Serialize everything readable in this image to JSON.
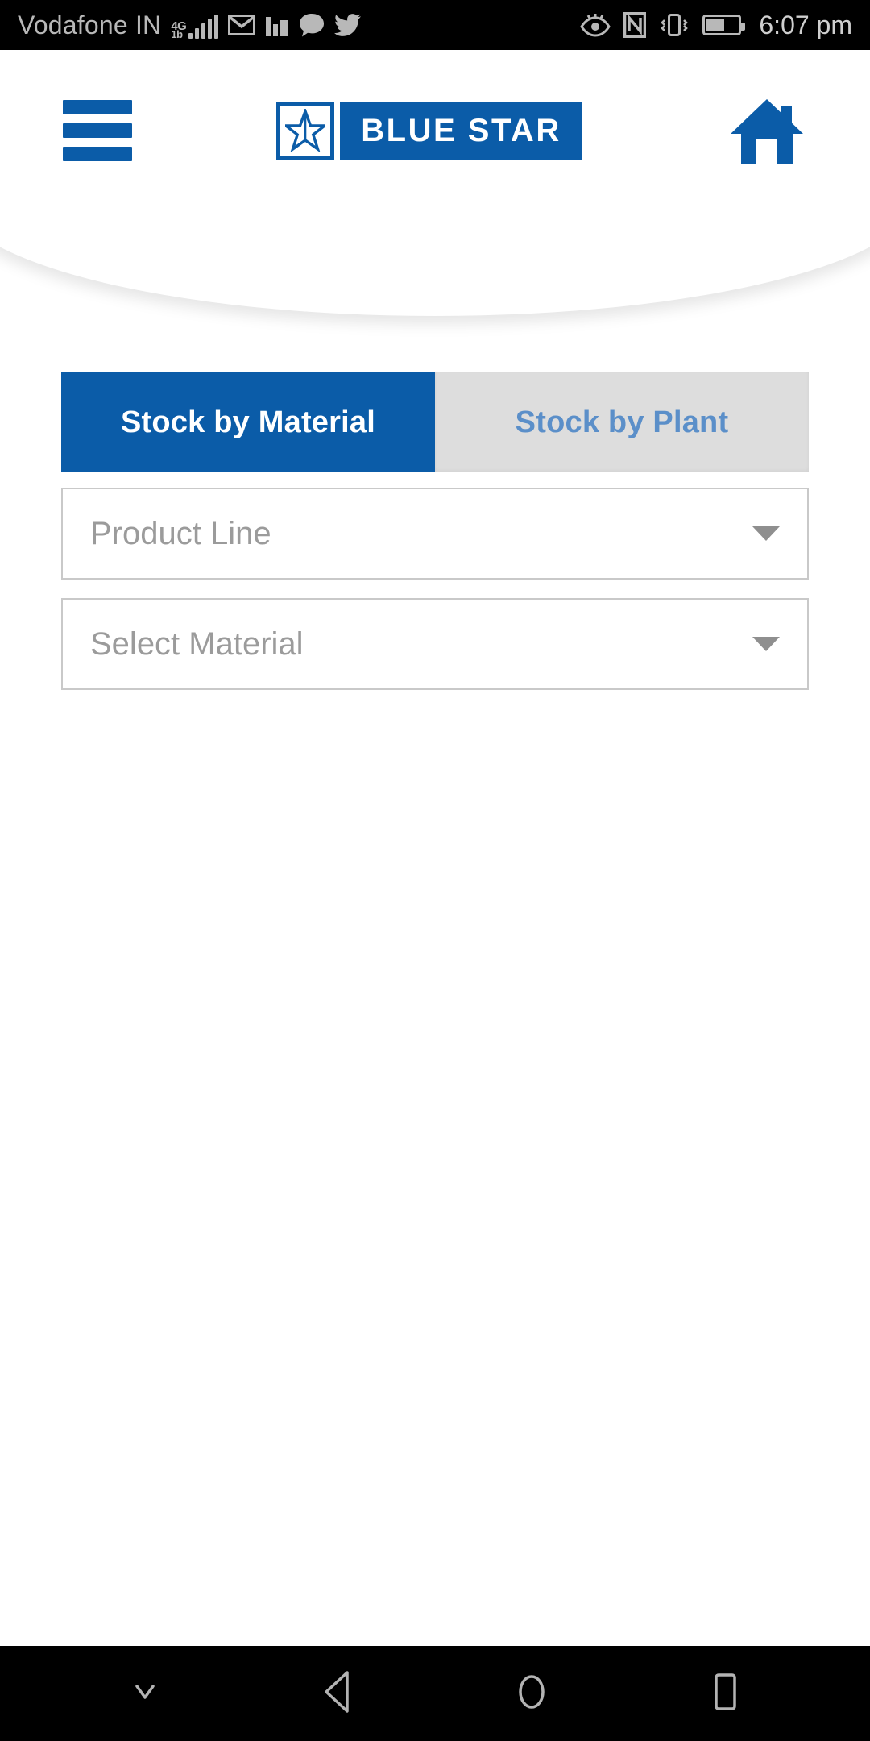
{
  "status_bar": {
    "carrier": "Vodafone IN",
    "network_type": "4G",
    "network_sub": "1b",
    "time": "6:07 pm",
    "battery_percent": 58,
    "icons": [
      "signal-bars-icon",
      "gmail-icon",
      "bar-chart-icon",
      "chat-bubble-icon",
      "twitter-icon",
      "eye-comfort-icon",
      "nfc-icon",
      "vibrate-icon",
      "battery-icon"
    ]
  },
  "header": {
    "menu_icon": "hamburger-menu-icon",
    "brand": "BLUE STAR",
    "brand_mark_icon": "blue-star-logo-icon",
    "home_icon": "home-icon"
  },
  "tabs": [
    {
      "label": "Stock by Material",
      "active": true
    },
    {
      "label": "Stock by Plant",
      "active": false
    }
  ],
  "fields": [
    {
      "placeholder": "Product Line",
      "value": "",
      "caret_icon": "chevron-down-icon"
    },
    {
      "placeholder": "Select Material",
      "value": "",
      "caret_icon": "chevron-down-icon"
    }
  ],
  "nav_bar": {
    "buttons": [
      {
        "name": "hide-keyboard",
        "icon": "chevron-down-icon"
      },
      {
        "name": "back",
        "icon": "back-triangle-icon"
      },
      {
        "name": "home",
        "icon": "home-circle-icon"
      },
      {
        "name": "recents",
        "icon": "recents-square-icon"
      }
    ]
  },
  "colors": {
    "brand_blue": "#0B5CA8",
    "inactive_tab_bg": "#DDDDDD",
    "inactive_tab_text": "#5B8FC9",
    "placeholder_text": "#9B9B9B",
    "field_border": "#C9C9C9",
    "status_bar_bg": "#000000",
    "nav_bar_bg": "#000000"
  }
}
